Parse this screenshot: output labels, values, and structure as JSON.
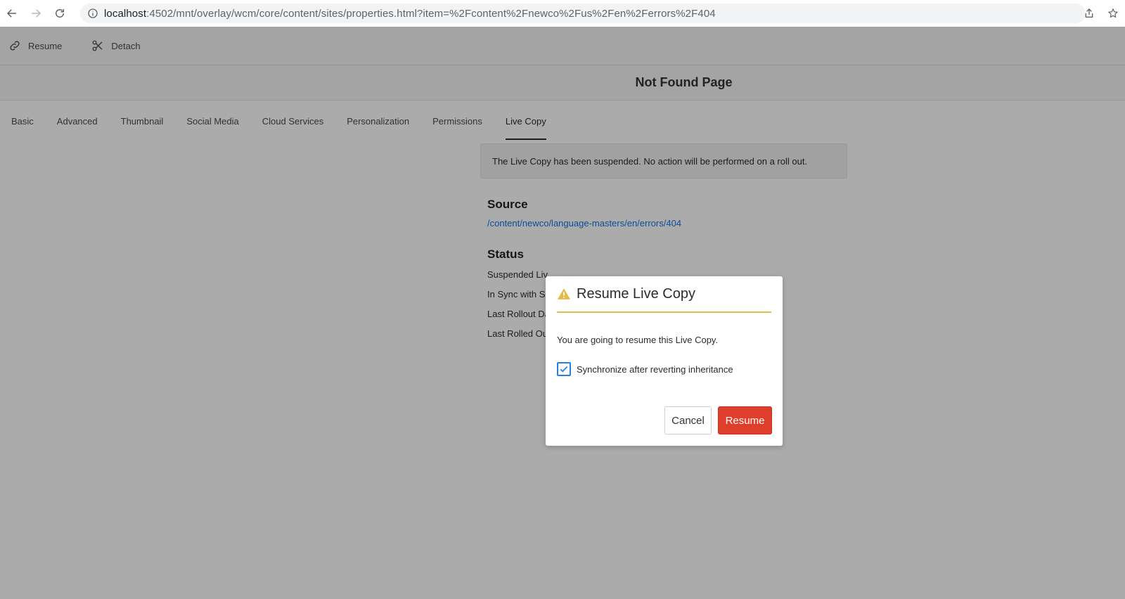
{
  "browser": {
    "url_host": "localhost",
    "url_rest": ":4502/mnt/overlay/wcm/core/content/sites/properties.html?item=%2Fcontent%2Fnewco%2Fus%2Fen%2Ferrors%2F404"
  },
  "actionbar": {
    "resume_label": "Resume",
    "detach_label": "Detach"
  },
  "page": {
    "title": "Not Found Page"
  },
  "tabs": [
    {
      "label": "Basic"
    },
    {
      "label": "Advanced"
    },
    {
      "label": "Thumbnail"
    },
    {
      "label": "Social Media"
    },
    {
      "label": "Cloud Services"
    },
    {
      "label": "Personalization"
    },
    {
      "label": "Permissions"
    },
    {
      "label": "Live Copy",
      "active": true
    }
  ],
  "livecopy": {
    "alert": "The Live Copy has been suspended. No action will be performed on a roll out.",
    "source_heading": "Source",
    "source_link": "/content/newco/language-masters/en/errors/404",
    "status_heading": "Status",
    "status_rows": [
      "Suspended Liv",
      "In Sync with So",
      "Last Rollout Da",
      "Last Rolled Ou"
    ]
  },
  "dialog": {
    "title": "Resume Live Copy",
    "message": "You are going to resume this Live Copy.",
    "checkbox_label": "Synchronize after reverting inheritance",
    "checkbox_checked": true,
    "cancel_label": "Cancel",
    "confirm_label": "Resume"
  },
  "colors": {
    "primary_button": "#e03e2d",
    "warning_accent": "#e8b94a",
    "checkbox_blue": "#2680eb",
    "link_blue": "#1473e6"
  }
}
